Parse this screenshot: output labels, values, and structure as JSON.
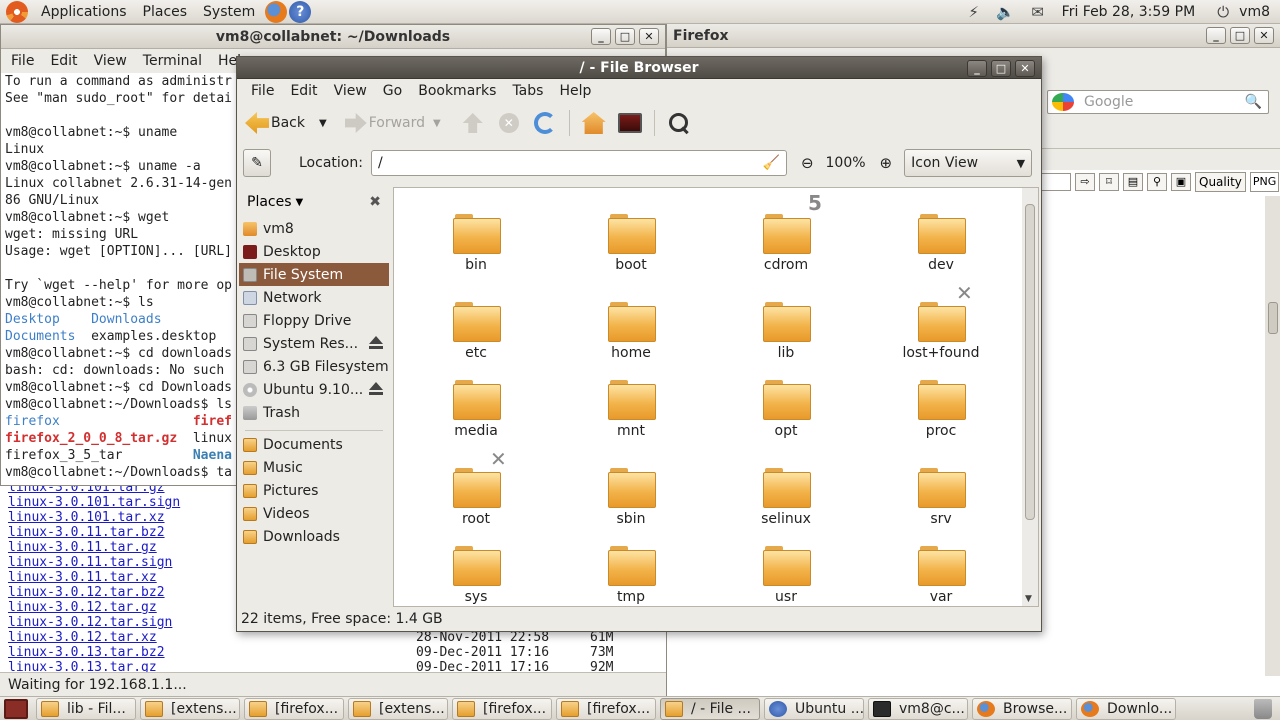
{
  "top_panel": {
    "menus": [
      "Applications",
      "Places",
      "System"
    ],
    "clock": "Fri Feb 28,  3:59 PM",
    "user": "vm8"
  },
  "terminal": {
    "title": "vm8@collabnet: ~/Downloads",
    "menus": [
      "File",
      "Edit",
      "View",
      "Terminal",
      "Help"
    ],
    "lines": [
      [
        {
          "t": "To run a command as administr"
        }
      ],
      [
        {
          "t": "See \"man sudo_root\" for detai"
        }
      ],
      [
        {
          "t": ""
        }
      ],
      [
        {
          "t": "vm8@collabnet:~$ uname"
        }
      ],
      [
        {
          "t": "Linux"
        }
      ],
      [
        {
          "t": "vm8@collabnet:~$ uname -a"
        }
      ],
      [
        {
          "t": "Linux collabnet 2.6.31-14-gen"
        }
      ],
      [
        {
          "t": "86 GNU/Linux"
        }
      ],
      [
        {
          "t": "vm8@collabnet:~$ wget"
        }
      ],
      [
        {
          "t": "wget: missing URL"
        }
      ],
      [
        {
          "t": "Usage: wget [OPTION]... [URL]"
        }
      ],
      [
        {
          "t": ""
        }
      ],
      [
        {
          "t": "Try `wget --help' for more op"
        }
      ],
      [
        {
          "t": "vm8@collabnet:~$ ls"
        }
      ],
      [
        {
          "t": "Desktop    Downloads",
          "c": "c-blue"
        }
      ],
      [
        {
          "t": "Documents",
          "c": "c-blue"
        },
        {
          "t": "  examples.desktop"
        }
      ],
      [
        {
          "t": "vm8@collabnet:~$ cd downloads"
        }
      ],
      [
        {
          "t": "bash: cd: downloads: No such"
        }
      ],
      [
        {
          "t": "vm8@collabnet:~$ cd Downloads"
        }
      ],
      [
        {
          "t": "vm8@collabnet:~/Downloads$ ls"
        }
      ],
      [
        {
          "t": "firefox",
          "c": "c-blue"
        },
        {
          "t": "                 "
        },
        {
          "t": "firef",
          "c": "c-red"
        }
      ],
      [
        {
          "t": "firefox_2_0_0_8_tar.gz",
          "c": "c-red"
        },
        {
          "t": "  linux"
        }
      ],
      [
        {
          "t": "firefox_3_5_tar"
        },
        {
          "t": "         "
        },
        {
          "t": "Naena",
          "c": "c-teal"
        }
      ],
      [
        {
          "t": "vm8@collabnet:~/Downloads$ ta"
        }
      ]
    ]
  },
  "firefox": {
    "title": "Firefox",
    "search_placeholder": "Google",
    "quality_label": "Quality",
    "format_value": "PNG",
    "status": "Waiting for 192.168.1.1...",
    "listing": [
      {
        "name": "linux-3.0.101.tar.gz",
        "date": "",
        "size": ""
      },
      {
        "name": "linux-3.0.101.tar.sign",
        "date": "",
        "size": ""
      },
      {
        "name": "linux-3.0.101.tar.xz",
        "date": "",
        "size": ""
      },
      {
        "name": "linux-3.0.11.tar.bz2",
        "date": "",
        "size": ""
      },
      {
        "name": "linux-3.0.11.tar.gz",
        "date": "",
        "size": ""
      },
      {
        "name": "linux-3.0.11.tar.sign",
        "date": "",
        "size": ""
      },
      {
        "name": "linux-3.0.11.tar.xz",
        "date": "",
        "size": ""
      },
      {
        "name": "linux-3.0.12.tar.bz2",
        "date": "",
        "size": ""
      },
      {
        "name": "linux-3.0.12.tar.gz",
        "date": "",
        "size": ""
      },
      {
        "name": "linux-3.0.12.tar.sign",
        "date": "",
        "size": ""
      },
      {
        "name": "linux-3.0.12.tar.xz",
        "date": "28-Nov-2011 22:58",
        "size": "61M"
      },
      {
        "name": "linux-3.0.13.tar.bz2",
        "date": "09-Dec-2011 17:16",
        "size": "73M"
      },
      {
        "name": "linux-3.0.13.tar.gz",
        "date": "09-Dec-2011 17:16",
        "size": "92M"
      }
    ]
  },
  "file_browser": {
    "title": "/ - File Browser",
    "menus": [
      "File",
      "Edit",
      "View",
      "Go",
      "Bookmarks",
      "Tabs",
      "Help"
    ],
    "back_label": "Back",
    "forward_label": "Forward",
    "location_label": "Location:",
    "location_value": "/",
    "zoom": "100%",
    "view_mode": "Icon View",
    "places_label": "Places",
    "places": [
      {
        "label": "vm8",
        "icon": "home"
      },
      {
        "label": "Desktop",
        "icon": "desk"
      },
      {
        "label": "File System",
        "icon": "fs",
        "selected": true
      },
      {
        "label": "Network",
        "icon": "net"
      },
      {
        "label": "Floppy Drive",
        "icon": "disk"
      },
      {
        "label": "System Res...",
        "icon": "disk",
        "eject": true
      },
      {
        "label": "6.3 GB Filesystem",
        "icon": "disk"
      },
      {
        "label": "Ubuntu 9.10...",
        "icon": "cd",
        "eject": true
      },
      {
        "label": "Trash",
        "icon": "trash"
      }
    ],
    "bookmarks": [
      {
        "label": "Documents",
        "icon": "folder"
      },
      {
        "label": "Music",
        "icon": "music"
      },
      {
        "label": "Pictures",
        "icon": "folder"
      },
      {
        "label": "Videos",
        "icon": "folder"
      },
      {
        "label": "Downloads",
        "icon": "folder"
      }
    ],
    "folders": [
      "bin",
      "boot",
      "cdrom",
      "dev",
      "etc",
      "home",
      "lib",
      "lost+found",
      "media",
      "mnt",
      "opt",
      "proc",
      "root",
      "sbin",
      "selinux",
      "srv",
      "sys",
      "tmp",
      "usr",
      "var"
    ],
    "status": "22 items, Free space: 1.4 GB"
  },
  "taskbar": {
    "tasks": [
      {
        "label": "lib - Fil...",
        "icon": "folder"
      },
      {
        "label": "[extens...",
        "icon": "folder"
      },
      {
        "label": "[firefox...",
        "icon": "folder"
      },
      {
        "label": "[extens...",
        "icon": "folder"
      },
      {
        "label": "[firefox...",
        "icon": "folder"
      },
      {
        "label": "[firefox...",
        "icon": "folder"
      },
      {
        "label": "/ - File ...",
        "icon": "folder",
        "active": true
      },
      {
        "label": "Ubuntu ...",
        "icon": "help"
      },
      {
        "label": "vm8@c...",
        "icon": "term"
      },
      {
        "label": "Browse...",
        "icon": "ff"
      },
      {
        "label": "Downlo...",
        "icon": "ff"
      }
    ]
  }
}
